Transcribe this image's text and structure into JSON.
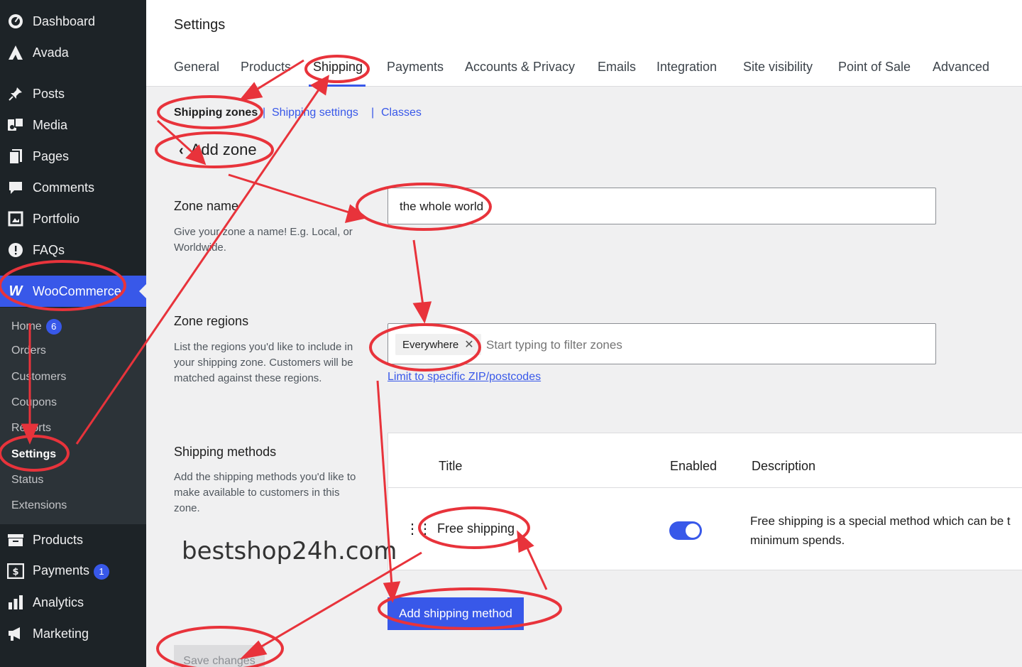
{
  "sidebar": {
    "items": [
      {
        "label": "Dashboard",
        "icon": "dashboard-icon"
      },
      {
        "label": "Avada",
        "icon": "avada-icon"
      },
      {
        "label": "Posts",
        "icon": "pin-icon"
      },
      {
        "label": "Media",
        "icon": "media-icon"
      },
      {
        "label": "Pages",
        "icon": "pages-icon"
      },
      {
        "label": "Comments",
        "icon": "comment-icon"
      },
      {
        "label": "Portfolio",
        "icon": "portfolio-icon"
      },
      {
        "label": "FAQs",
        "icon": "info-icon"
      },
      {
        "label": "WooCommerce",
        "icon": "woo-icon"
      }
    ],
    "submenu": [
      {
        "label": "Home",
        "badge": "6"
      },
      {
        "label": "Orders"
      },
      {
        "label": "Customers"
      },
      {
        "label": "Coupons"
      },
      {
        "label": "Reports"
      },
      {
        "label": "Settings"
      },
      {
        "label": "Status"
      },
      {
        "label": "Extensions"
      }
    ],
    "bottom_items": [
      {
        "label": "Products",
        "icon": "products-icon"
      },
      {
        "label": "Payments",
        "icon": "payments-icon",
        "badge": "1"
      },
      {
        "label": "Analytics",
        "icon": "analytics-icon"
      },
      {
        "label": "Marketing",
        "icon": "megaphone-icon"
      }
    ]
  },
  "header": {
    "title": "Settings",
    "tabs": [
      "General",
      "Products",
      "Shipping",
      "Payments",
      "Accounts & Privacy",
      "Emails",
      "Integration",
      "Site visibility",
      "Point of Sale",
      "Advanced"
    ],
    "active_tab": "Shipping"
  },
  "subnav": {
    "zones": "Shipping zones",
    "sep1": "|",
    "settings": "Shipping settings",
    "sep2": "|",
    "classes": "Classes"
  },
  "zone": {
    "back_title": "Add zone",
    "name_title": "Zone name",
    "name_desc": "Give your zone a name! E.g. Local, or Worldwide.",
    "name_value": "the whole world",
    "regions_title": "Zone regions",
    "regions_desc": "List the regions you'd like to include in your shipping zone. Customers will be matched against these regions.",
    "region_chip": "Everywhere",
    "region_placeholder": "Start typing to filter zones",
    "limit_link": "Limit to specific ZIP/postcodes",
    "methods_title": "Shipping methods",
    "methods_desc": "Add the shipping methods you'd like to make available to customers in this zone."
  },
  "methods_table": {
    "headers": {
      "title": "Title",
      "enabled": "Enabled",
      "description": "Description"
    },
    "rows": [
      {
        "title": "Free shipping",
        "enabled": true,
        "desc_line1": "Free shipping is a special method which can be t",
        "desc_line2": "minimum spends."
      }
    ]
  },
  "actions": {
    "add_method": "Add shipping method",
    "save": "Save changes"
  },
  "watermark": "bestshop24h.com",
  "colors": {
    "sidebar_bg": "#1d2327",
    "accent": "#3858e9",
    "annotation": "#e8333b"
  }
}
